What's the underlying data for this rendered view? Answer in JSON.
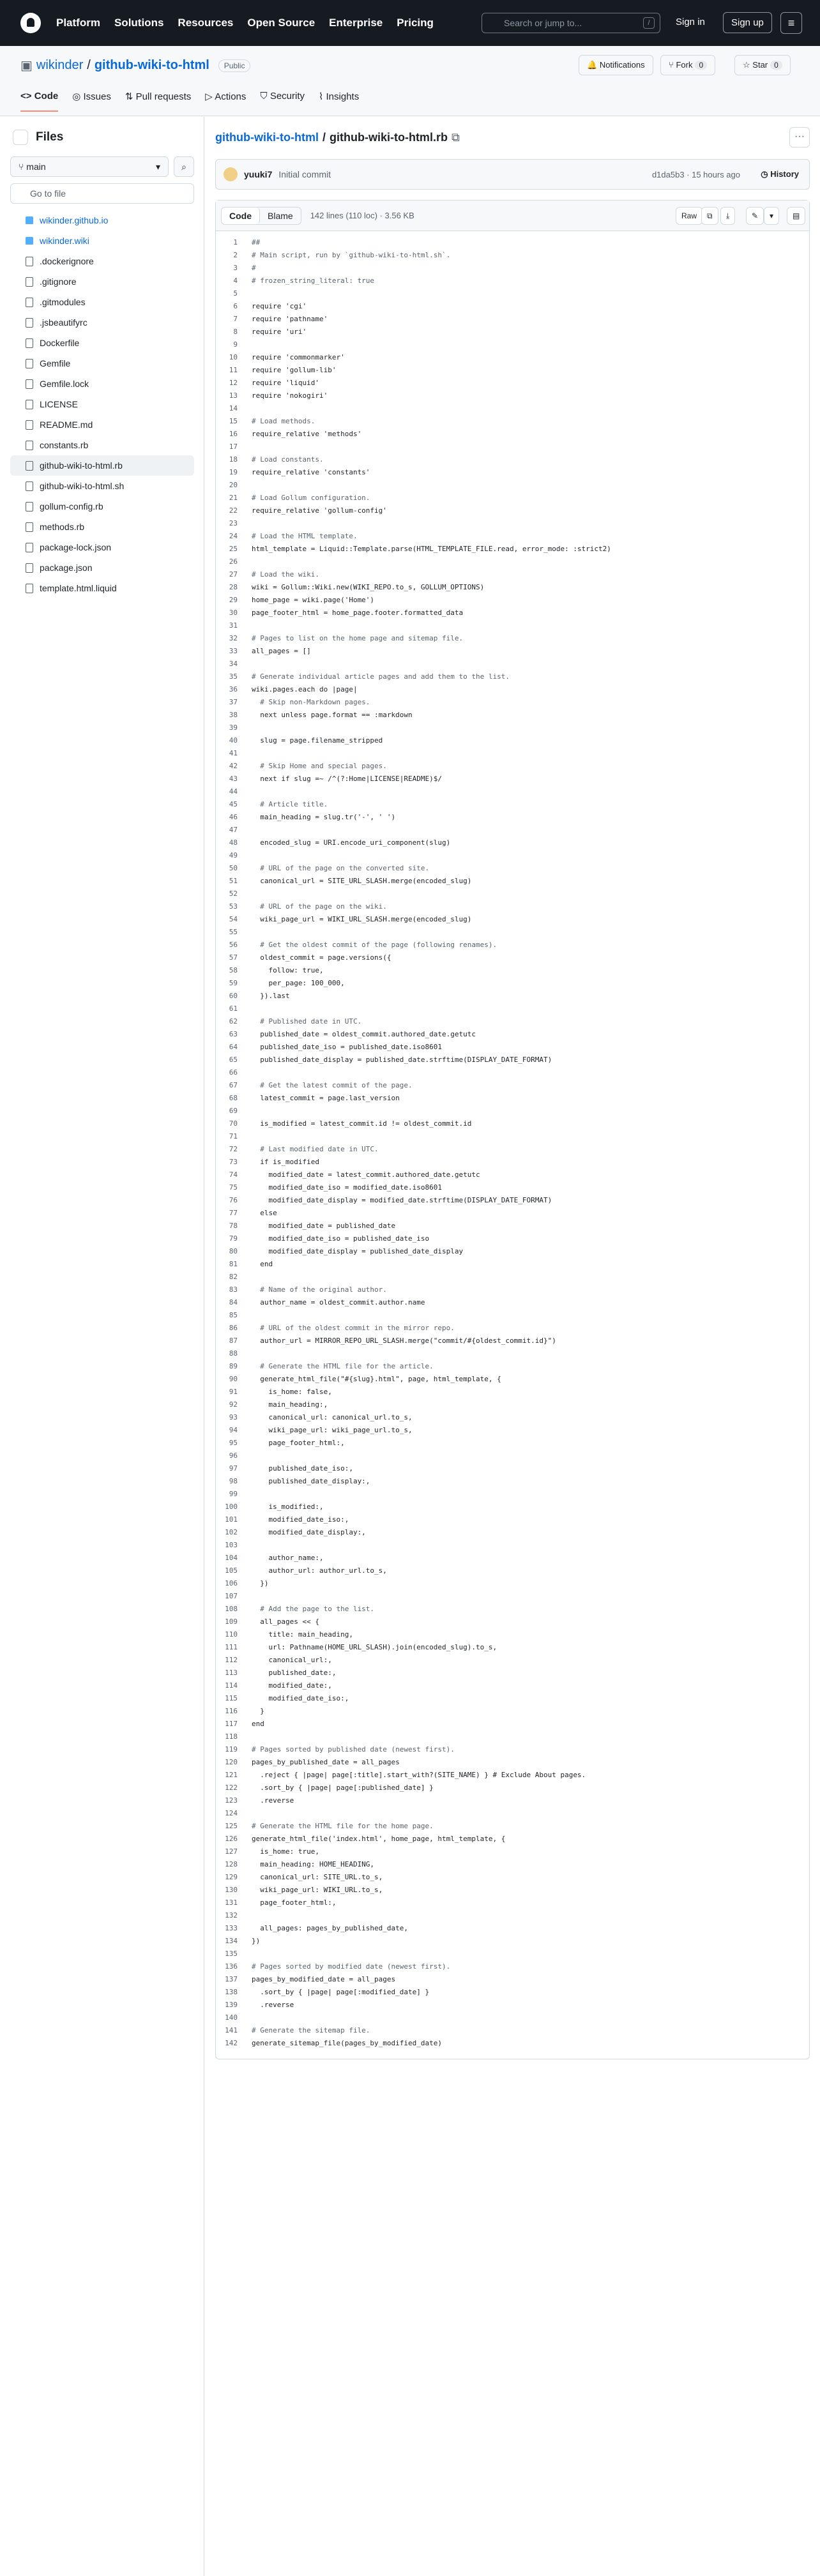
{
  "header": {
    "nav": [
      "Platform",
      "Solutions",
      "Resources",
      "Open Source",
      "Enterprise",
      "Pricing"
    ],
    "search_placeholder": "Search or jump to...",
    "search_key": "/",
    "sign_in": "Sign in",
    "sign_up": "Sign up"
  },
  "repo": {
    "owner": "wikinder",
    "sep": "/",
    "name": "github-wiki-to-html",
    "visibility": "Public",
    "notifications": "Notifications",
    "fork": "Fork",
    "fork_count": "0",
    "star": "Star",
    "star_count": "0",
    "tabs": [
      "Code",
      "Issues",
      "Pull requests",
      "Actions",
      "Security",
      "Insights"
    ]
  },
  "sidebar": {
    "title": "Files",
    "branch": "main",
    "go_to_file": "Go to file",
    "items": [
      {
        "label": "wikinder.github.io",
        "type": "dir"
      },
      {
        "label": "wikinder.wiki",
        "type": "dir"
      },
      {
        "label": ".dockerignore",
        "type": "file"
      },
      {
        "label": ".gitignore",
        "type": "file"
      },
      {
        "label": ".gitmodules",
        "type": "file"
      },
      {
        "label": ".jsbeautifyrc",
        "type": "file"
      },
      {
        "label": "Dockerfile",
        "type": "file"
      },
      {
        "label": "Gemfile",
        "type": "file"
      },
      {
        "label": "Gemfile.lock",
        "type": "file"
      },
      {
        "label": "LICENSE",
        "type": "file"
      },
      {
        "label": "README.md",
        "type": "file"
      },
      {
        "label": "constants.rb",
        "type": "file"
      },
      {
        "label": "github-wiki-to-html.rb",
        "type": "file",
        "selected": true
      },
      {
        "label": "github-wiki-to-html.sh",
        "type": "file"
      },
      {
        "label": "gollum-config.rb",
        "type": "file"
      },
      {
        "label": "methods.rb",
        "type": "file"
      },
      {
        "label": "package-lock.json",
        "type": "file"
      },
      {
        "label": "package.json",
        "type": "file"
      },
      {
        "label": "template.html.liquid",
        "type": "file"
      }
    ]
  },
  "file": {
    "breadcrumb_repo": "github-wiki-to-html",
    "breadcrumb_sep": "/",
    "breadcrumb_file": "github-wiki-to-html.rb",
    "author": "yuuki7",
    "commit_msg": "Initial commit",
    "commit_sha": "d1da5b3 · 15 hours ago",
    "history": "History",
    "view_code": "Code",
    "view_blame": "Blame",
    "meta": "142 lines (110 loc) · 3.56 KB",
    "raw": "Raw"
  },
  "code_lines": [
    "##",
    "# Main script, run by `github-wiki-to-html.sh`.",
    "#",
    "# frozen_string_literal: true",
    "",
    "require 'cgi'",
    "require 'pathname'",
    "require 'uri'",
    "",
    "require 'commonmarker'",
    "require 'gollum-lib'",
    "require 'liquid'",
    "require 'nokogiri'",
    "",
    "# Load methods.",
    "require_relative 'methods'",
    "",
    "# Load constants.",
    "require_relative 'constants'",
    "",
    "# Load Gollum configuration.",
    "require_relative 'gollum-config'",
    "",
    "# Load the HTML template.",
    "html_template = Liquid::Template.parse(HTML_TEMPLATE_FILE.read, error_mode: :strict2)",
    "",
    "# Load the wiki.",
    "wiki = Gollum::Wiki.new(WIKI_REPO.to_s, GOLLUM_OPTIONS)",
    "home_page = wiki.page('Home')",
    "page_footer_html = home_page.footer.formatted_data",
    "",
    "# Pages to list on the home page and sitemap file.",
    "all_pages = []",
    "",
    "# Generate individual article pages and add them to the list.",
    "wiki.pages.each do |page|",
    "  # Skip non-Markdown pages.",
    "  next unless page.format == :markdown",
    "",
    "  slug = page.filename_stripped",
    "",
    "  # Skip Home and special pages.",
    "  next if slug =~ /^(?:Home|LICENSE|README)$/",
    "",
    "  # Article title.",
    "  main_heading = slug.tr('-', ' ')",
    "",
    "  encoded_slug = URI.encode_uri_component(slug)",
    "",
    "  # URL of the page on the converted site.",
    "  canonical_url = SITE_URL_SLASH.merge(encoded_slug)",
    "",
    "  # URL of the page on the wiki.",
    "  wiki_page_url = WIKI_URL_SLASH.merge(encoded_slug)",
    "",
    "  # Get the oldest commit of the page (following renames).",
    "  oldest_commit = page.versions({",
    "    follow: true,",
    "    per_page: 100_000,",
    "  }).last",
    "",
    "  # Published date in UTC.",
    "  published_date = oldest_commit.authored_date.getutc",
    "  published_date_iso = published_date.iso8601",
    "  published_date_display = published_date.strftime(DISPLAY_DATE_FORMAT)",
    "",
    "  # Get the latest commit of the page.",
    "  latest_commit = page.last_version",
    "",
    "  is_modified = latest_commit.id != oldest_commit.id",
    "",
    "  # Last modified date in UTC.",
    "  if is_modified",
    "    modified_date = latest_commit.authored_date.getutc",
    "    modified_date_iso = modified_date.iso8601",
    "    modified_date_display = modified_date.strftime(DISPLAY_DATE_FORMAT)",
    "  else",
    "    modified_date = published_date",
    "    modified_date_iso = published_date_iso",
    "    modified_date_display = published_date_display",
    "  end",
    "",
    "  # Name of the original author.",
    "  author_name = oldest_commit.author.name",
    "",
    "  # URL of the oldest commit in the mirror repo.",
    "  author_url = MIRROR_REPO_URL_SLASH.merge(\"commit/#{oldest_commit.id}\")",
    "",
    "  # Generate the HTML file for the article.",
    "  generate_html_file(\"#{slug}.html\", page, html_template, {",
    "    is_home: false,",
    "    main_heading:,",
    "    canonical_url: canonical_url.to_s,",
    "    wiki_page_url: wiki_page_url.to_s,",
    "    page_footer_html:,",
    "",
    "    published_date_iso:,",
    "    published_date_display:,",
    "",
    "    is_modified:,",
    "    modified_date_iso:,",
    "    modified_date_display:,",
    "",
    "    author_name:,",
    "    author_url: author_url.to_s,",
    "  })",
    "",
    "  # Add the page to the list.",
    "  all_pages << {",
    "    title: main_heading,",
    "    url: Pathname(HOME_URL_SLASH).join(encoded_slug).to_s,",
    "    canonical_url:,",
    "    published_date:,",
    "    modified_date:,",
    "    modified_date_iso:,",
    "  }",
    "end",
    "",
    "# Pages sorted by published date (newest first).",
    "pages_by_published_date = all_pages",
    "  .reject { |page| page[:title].start_with?(SITE_NAME) } # Exclude About pages.",
    "  .sort_by { |page| page[:published_date] }",
    "  .reverse",
    "",
    "# Generate the HTML file for the home page.",
    "generate_html_file('index.html', home_page, html_template, {",
    "  is_home: true,",
    "  main_heading: HOME_HEADING,",
    "  canonical_url: SITE_URL.to_s,",
    "  wiki_page_url: WIKI_URL.to_s,",
    "  page_footer_html:,",
    "",
    "  all_pages: pages_by_published_date,",
    "})",
    "",
    "# Pages sorted by modified date (newest first).",
    "pages_by_modified_date = all_pages",
    "  .sort_by { |page| page[:modified_date] }",
    "  .reverse",
    "",
    "# Generate the sitemap file.",
    "generate_sitemap_file(pages_by_modified_date)"
  ]
}
